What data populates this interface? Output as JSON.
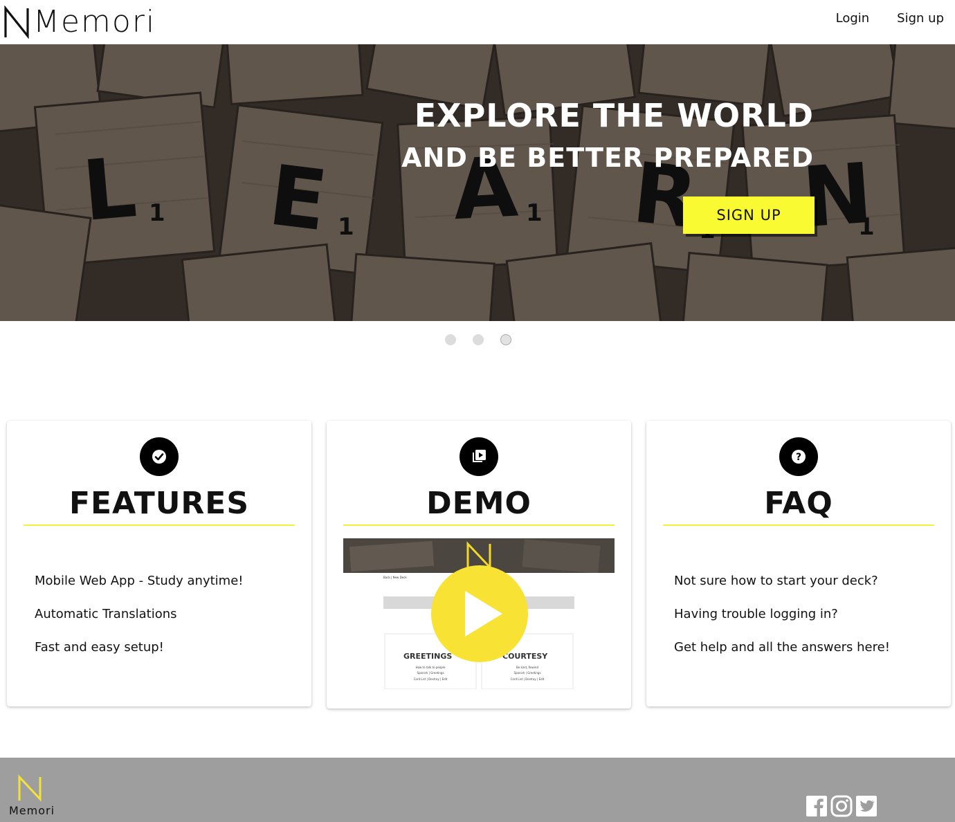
{
  "header": {
    "brand": "Memori",
    "nav": {
      "login": "Login",
      "signup": "Sign up"
    }
  },
  "hero": {
    "title": "EXPLORE THE WORLD",
    "subtitle": "AND BE BETTER PREPARED",
    "cta": "SIGN UP",
    "background_word": [
      "L",
      "E",
      "A",
      "R",
      "N"
    ],
    "carousel_slides": 3,
    "active_slide": 3
  },
  "cards": {
    "features": {
      "icon": "check-circle-icon",
      "title": "FEATURES",
      "items": [
        "Mobile Web App - Study anytime!",
        "Automatic Translations",
        "Fast and easy setup!"
      ]
    },
    "demo": {
      "icon": "video-library-icon",
      "title": "DEMO",
      "thumb": {
        "nav": "Back | New Deck",
        "categories": [
          {
            "name": "GREETINGS",
            "desc": "How to talk to people",
            "lang": "Spanish | Greetings",
            "links": "Card List | Destroy | Edit"
          },
          {
            "name": "COURTESY",
            "desc": "Be kind, Rewind",
            "lang": "Spanish | Greetings",
            "links": "Card List | Destroy | Edit"
          }
        ]
      }
    },
    "faq": {
      "icon": "help-circle-icon",
      "title": "FAQ",
      "items": [
        "Not sure how to start your deck?",
        "Having trouble logging in?",
        "Get help and all the answers here!"
      ]
    }
  },
  "footer": {
    "brand": "Memori",
    "social": [
      "facebook-icon",
      "instagram-icon",
      "twitter-icon"
    ]
  },
  "colors": {
    "accent_yellow": "#fafa32",
    "play_yellow": "#f8e233",
    "footer_gray": "#9e9e9e",
    "icon_black": "#000000"
  }
}
